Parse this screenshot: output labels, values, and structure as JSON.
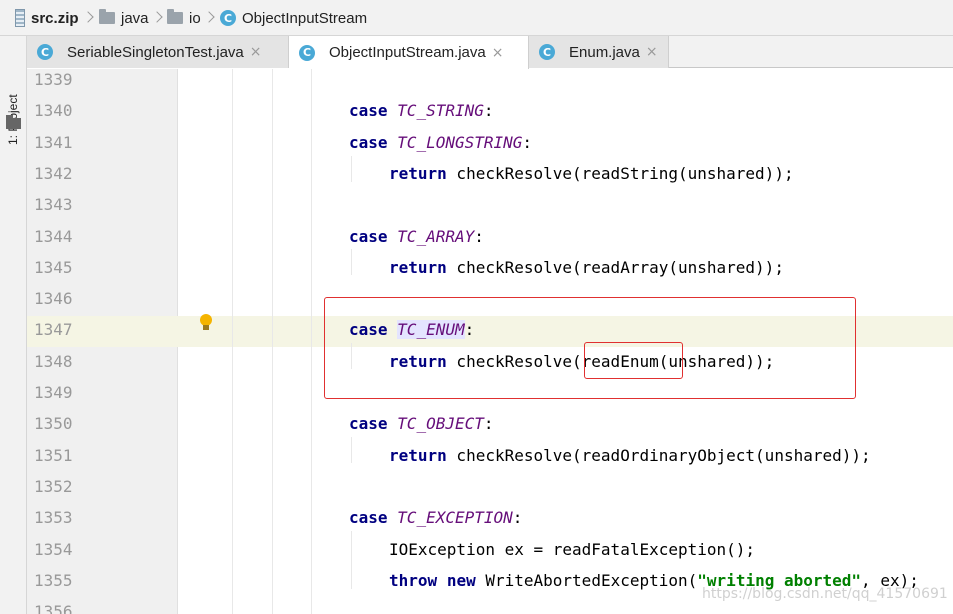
{
  "breadcrumb": {
    "items": [
      {
        "label": "src.zip",
        "icon": "zip-archive-icon"
      },
      {
        "label": "java",
        "icon": "folder-icon"
      },
      {
        "label": "io",
        "icon": "folder-icon"
      },
      {
        "label": "ObjectInputStream",
        "icon": "class-icon"
      }
    ]
  },
  "toolwindow": {
    "project_label": "1: Project"
  },
  "tabs": [
    {
      "label": "SeriableSingletonTest.java",
      "close": "×",
      "active": false
    },
    {
      "label": "ObjectInputStream.java",
      "close": "×",
      "active": true
    },
    {
      "label": "Enum.java",
      "close": "×",
      "active": false
    }
  ],
  "icons": {
    "class_letter": "C"
  },
  "editor": {
    "lines": [
      {
        "num": "1339"
      },
      {
        "num": "1340",
        "indent": 1,
        "tokens": [
          [
            "kw",
            "case"
          ],
          [
            "t",
            " "
          ],
          [
            "cst",
            "TC_STRING"
          ],
          [
            "t",
            ":"
          ]
        ]
      },
      {
        "num": "1341",
        "indent": 1,
        "tokens": [
          [
            "kw",
            "case"
          ],
          [
            "t",
            " "
          ],
          [
            "cst",
            "TC_LONGSTRING"
          ],
          [
            "t",
            ":"
          ]
        ]
      },
      {
        "num": "1342",
        "indent": 2,
        "tokens": [
          [
            "kw",
            "return"
          ],
          [
            "t",
            " checkResolve(readString(unshared));"
          ]
        ]
      },
      {
        "num": "1343"
      },
      {
        "num": "1344",
        "indent": 1,
        "tokens": [
          [
            "kw",
            "case"
          ],
          [
            "t",
            " "
          ],
          [
            "cst",
            "TC_ARRAY"
          ],
          [
            "t",
            ":"
          ]
        ]
      },
      {
        "num": "1345",
        "indent": 2,
        "tokens": [
          [
            "kw",
            "return"
          ],
          [
            "t",
            " checkResolve(readArray(unshared));"
          ]
        ]
      },
      {
        "num": "1346"
      },
      {
        "num": "1347",
        "indent": 1,
        "current": true,
        "tokens": [
          [
            "kw",
            "case"
          ],
          [
            "t",
            " "
          ],
          [
            "cst hl",
            "TC_ENUM"
          ],
          [
            "t",
            ":"
          ]
        ]
      },
      {
        "num": "1348",
        "indent": 2,
        "tokens": [
          [
            "kw",
            "return"
          ],
          [
            "t",
            " checkResolve(readEnum(unshared));"
          ]
        ]
      },
      {
        "num": "1349"
      },
      {
        "num": "1350",
        "indent": 1,
        "tokens": [
          [
            "kw",
            "case"
          ],
          [
            "t",
            " "
          ],
          [
            "cst",
            "TC_OBJECT"
          ],
          [
            "t",
            ":"
          ]
        ]
      },
      {
        "num": "1351",
        "indent": 2,
        "tokens": [
          [
            "kw",
            "return"
          ],
          [
            "t",
            " checkResolve(readOrdinaryObject(unshared));"
          ]
        ]
      },
      {
        "num": "1352"
      },
      {
        "num": "1353",
        "indent": 1,
        "tokens": [
          [
            "kw",
            "case"
          ],
          [
            "t",
            " "
          ],
          [
            "cst",
            "TC_EXCEPTION"
          ],
          [
            "t",
            ":"
          ]
        ]
      },
      {
        "num": "1354",
        "indent": 2,
        "tokens": [
          [
            "t",
            "IOException ex = readFatalException();"
          ]
        ]
      },
      {
        "num": "1355",
        "indent": 2,
        "tokens": [
          [
            "kw",
            "throw"
          ],
          [
            "t",
            " "
          ],
          [
            "kw",
            "new"
          ],
          [
            "t",
            " WriteAbortedException("
          ],
          [
            "str",
            "\"writing aborted\""
          ],
          [
            "t",
            ", ex);"
          ]
        ]
      },
      {
        "num": "1356"
      }
    ]
  },
  "watermark": "https://blog.csdn.net/qq_41570691",
  "colors": {
    "keyword": "#000080",
    "constant": "#660e7a",
    "string": "#008000",
    "annotation_box": "#e03030",
    "current_line": "#f5f5e4"
  }
}
